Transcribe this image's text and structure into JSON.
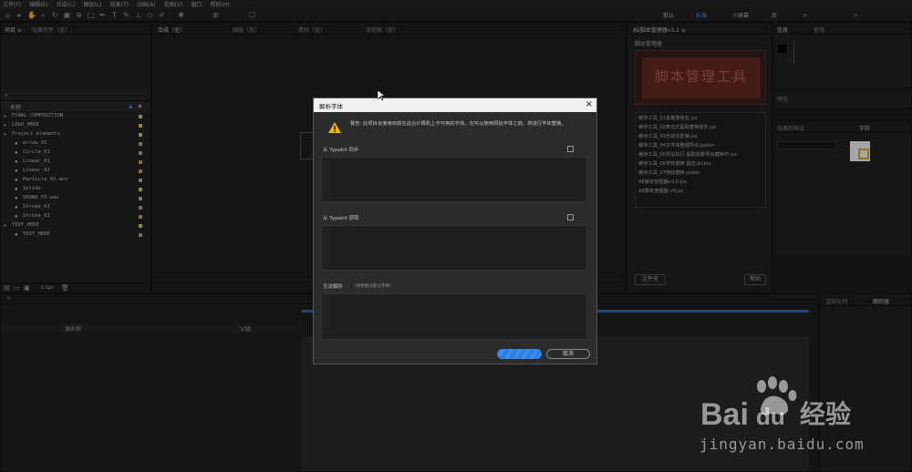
{
  "menubar": [
    "文件(F)",
    "编辑(E)",
    "合成(C)",
    "图层(L)",
    "效果(T)",
    "动画(A)",
    "视图(V)",
    "窗口",
    "帮助(H)"
  ],
  "workspaces": {
    "default": "默认",
    "standard": "标准",
    "small": "小屏幕",
    "lib": "库"
  },
  "tabs": {
    "project": "项目 ≡",
    "effects": "效果控件（无）",
    "comp": "合成（无）",
    "layer": "图层（无）",
    "footage": "素材（无）",
    "flow": "流程图（无）",
    "script": "AE脚本管理器v3.1 ≡",
    "info": "信息",
    "audio": "音频",
    "preview": "预览",
    "effects_presets": "效果和预设",
    "char": "字符",
    "render": "渲染队列",
    "tracker": "跟踪器"
  },
  "project": {
    "col_name": "名称",
    "items": [
      {
        "label": "FINAL COMPOSITION",
        "indent": 0,
        "color": "#e2c96a"
      },
      {
        "label": "LOGO_HERE",
        "indent": 0,
        "color": "#e2c96a"
      },
      {
        "label": "Project elements",
        "indent": 0,
        "color": "#e2c96a"
      },
      {
        "label": "arrow_01",
        "indent": 1,
        "color": "#c8a890"
      },
      {
        "label": "Circle_01",
        "indent": 1,
        "color": "#c8a890"
      },
      {
        "label": "Linear_01",
        "indent": 1,
        "color": "#c8a890"
      },
      {
        "label": "Linear_02",
        "indent": 1,
        "color": "#c8a890"
      },
      {
        "label": "Particle_01.mov",
        "indent": 1,
        "color": "#9fb8c8"
      },
      {
        "label": "Solids",
        "indent": 1,
        "color": "#e2c96a"
      },
      {
        "label": "SOUND FX.wav",
        "indent": 1,
        "color": "#a0c0a0"
      },
      {
        "label": "Stroke_01",
        "indent": 1,
        "color": "#c8a890"
      },
      {
        "label": "Stroke_02",
        "indent": 1,
        "color": "#c8a890"
      },
      {
        "label": "TEXT_HERE",
        "indent": 0,
        "color": "#e2c96a"
      },
      {
        "label": "TEXT_HERE",
        "indent": 1,
        "color": "#c8a890"
      }
    ],
    "bpc": "8 bpc"
  },
  "script_panel": {
    "subtitle": "脚本管理器",
    "banner": "脚本管理工具",
    "items": [
      "缓存工具_01批量重命名.jsx",
      "缓存工具_02表达式提取替换插件.jsx",
      "缓存工具_03自动化剪辑.jsx",
      "缓存工具_04文件夹整理导出.jsxbin",
      "缓存工具_05预设执行 提取批量导出替换中.jsx",
      "缓存工具_06字体替换 首选.jsxbin",
      "缓存工具_07特效替换.jsxbin",
      "AE脚本管理器v3.0.jsx",
      "AE脚本管理器.vfcjsx"
    ],
    "btn_left": "文件夹",
    "btn_right": "帮助"
  },
  "timeline": {
    "col_name": "源名称",
    "col_parent": "父级"
  },
  "dialog": {
    "title": "解析字体",
    "warning": "警告: 此项目会使用目前在这台计算机上不可用的字体。在可以使用原始字体之前，将进行字体替换。",
    "sync_label": "从 Typekit 同步",
    "get_label": "从 Typekit 获取",
    "unresolved_label": "无法解析",
    "unresolved_note": "(将更换为默认字体)",
    "ok_label": "",
    "cancel_label": "取消"
  },
  "watermark": {
    "brand": "Bai du 经验",
    "url": "jingyan.baidu.com"
  }
}
